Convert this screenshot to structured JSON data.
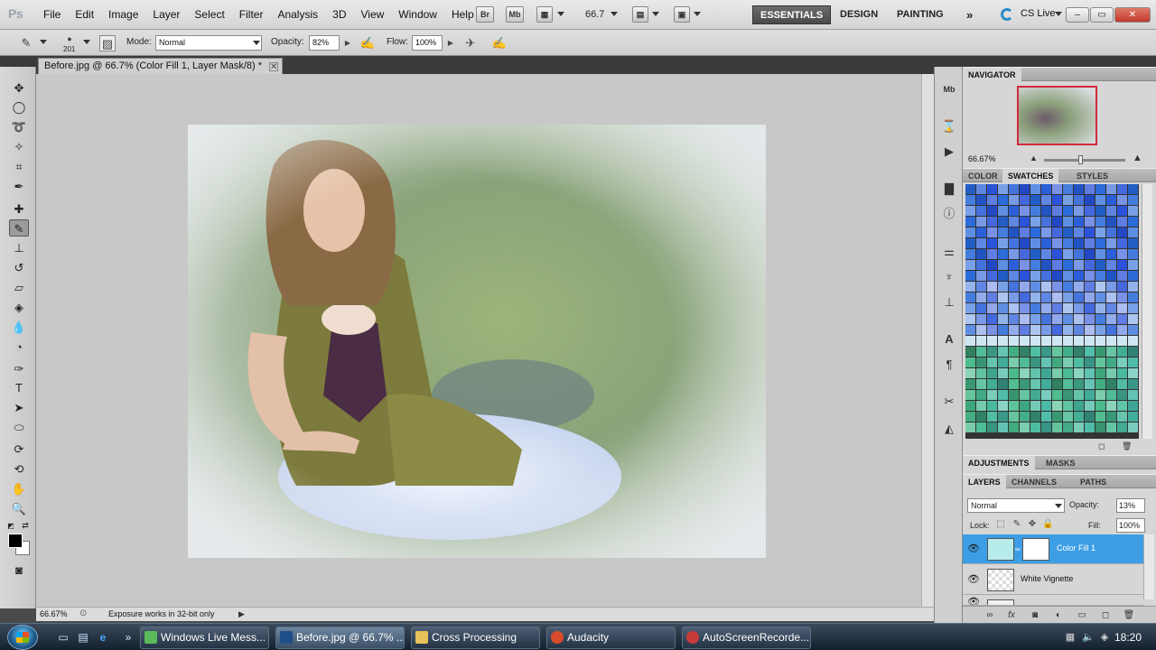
{
  "app": {
    "logo": "Ps",
    "menu": [
      "File",
      "Edit",
      "Image",
      "Layer",
      "Select",
      "Filter",
      "Analysis",
      "3D",
      "View",
      "Window",
      "Help"
    ],
    "app_buttons": [
      "Br",
      "Mb"
    ],
    "zoom": "66.7",
    "workspaces": [
      "ESSENTIALS",
      "DESIGN",
      "PAINTING"
    ],
    "more_workspaces": "»",
    "cs_live": "CS Live",
    "window_controls": [
      "–",
      "▭",
      "✕"
    ]
  },
  "options_bar": {
    "brush_size": "201",
    "mode_label": "Mode:",
    "mode_value": "Normal",
    "opacity_label": "Opacity:",
    "opacity_value": "82%",
    "flow_label": "Flow:",
    "flow_value": "100%"
  },
  "document": {
    "tab_title": "Before.jpg @ 66.7% (Color Fill 1, Layer Mask/8) *",
    "tab_close": "✕",
    "status_zoom": "66.67%",
    "status_info": "Exposure works in 32-bit only"
  },
  "tools": [
    "move-tool",
    "marquee-tool",
    "lasso-tool",
    "quick-select-tool",
    "crop-tool",
    "eyedropper-tool",
    "healing-brush-tool",
    "brush-tool",
    "clone-stamp-tool",
    "history-brush-tool",
    "eraser-tool",
    "paint-bucket-tool",
    "blur-tool",
    "dodge-tool",
    "pen-tool",
    "type-tool",
    "path-select-tool",
    "shape-tool",
    "3d-rotate-tool",
    "3d-orbit-tool",
    "hand-tool",
    "zoom-tool"
  ],
  "colors": {
    "foreground": "#000000",
    "background": "#ffffff",
    "selection_blue": "#3d9ee5",
    "navigator_frame": "#d3283a"
  },
  "panels": {
    "navigator": {
      "title": "NAVIGATOR",
      "zoom": "66.67%"
    },
    "color_tabs": [
      "COLOR",
      "SWATCHES",
      "STYLES"
    ],
    "adjust_tabs": [
      "ADJUSTMENTS",
      "MASKS"
    ],
    "layers_tabs": [
      "LAYERS",
      "CHANNELS",
      "PATHS"
    ],
    "layers": {
      "blend_mode": "Normal",
      "opacity_label": "Opacity:",
      "opacity_value": "13%",
      "lock_label": "Lock:",
      "fill_label": "Fill:",
      "fill_value": "100%",
      "items": [
        {
          "name": "Color Fill 1",
          "selected": true
        },
        {
          "name": "White Vignette",
          "selected": false
        }
      ]
    }
  },
  "taskbar": {
    "items": [
      {
        "label": "Windows Live Mess...",
        "active": false
      },
      {
        "label": "Before.jpg @ 66.7% ...",
        "active": true
      },
      {
        "label": "Cross Processing",
        "active": false
      },
      {
        "label": "Audacity",
        "active": false
      },
      {
        "label": "AutoScreenRecorde...",
        "active": false
      }
    ],
    "clock": "18:20"
  }
}
